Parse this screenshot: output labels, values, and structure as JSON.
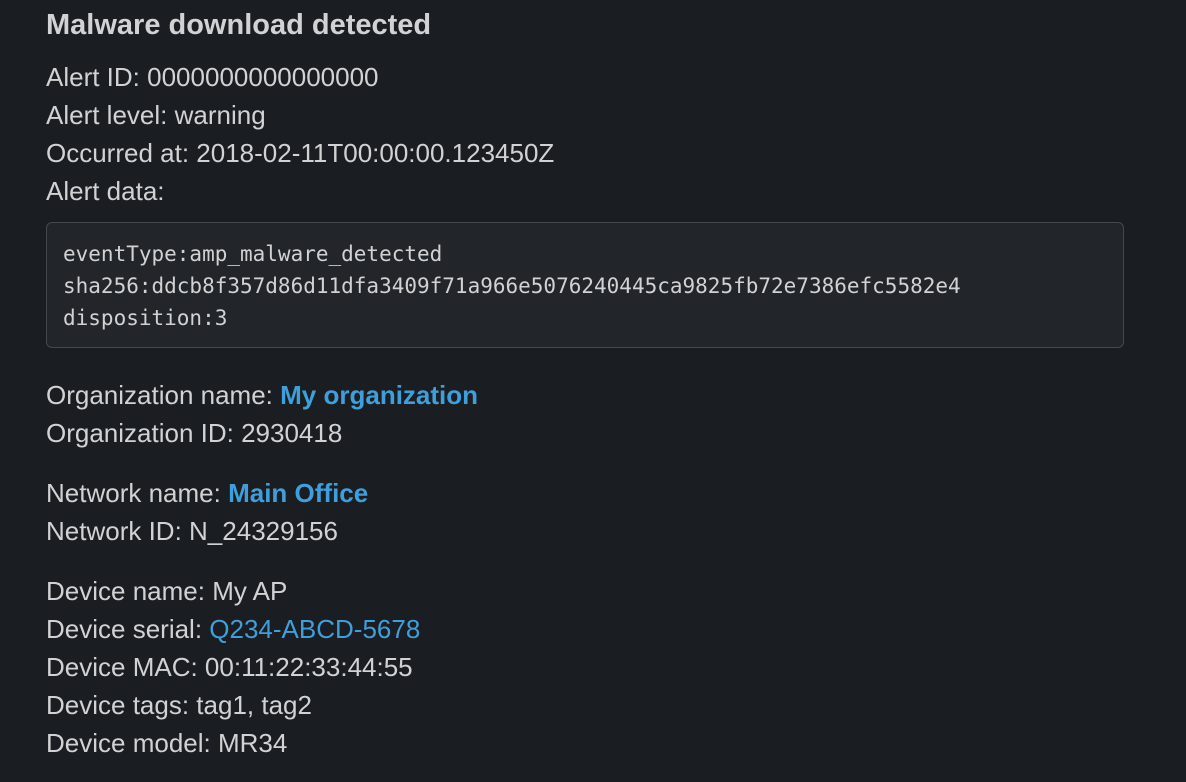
{
  "title": "Malware download detected",
  "alert": {
    "id_label": "Alert ID: ",
    "id_value": "0000000000000000",
    "level_label": "Alert level: ",
    "level_value": "warning",
    "occurred_label": "Occurred at: ",
    "occurred_value": "2018-02-11T00:00:00.123450Z",
    "data_label": "Alert data:",
    "data_lines": [
      "eventType:amp_malware_detected",
      "sha256:ddcb8f357d86d11dfa3409f71a966e5076240445ca9825fb72e7386efc5582e4",
      "disposition:3"
    ]
  },
  "organization": {
    "name_label": "Organization name: ",
    "name_value": "My organization",
    "id_label": "Organization ID: ",
    "id_value": "2930418"
  },
  "network": {
    "name_label": "Network name: ",
    "name_value": "Main Office",
    "id_label": "Network ID: ",
    "id_value": "N_24329156"
  },
  "device": {
    "name_label": "Device name: ",
    "name_value": "My AP",
    "serial_label": "Device serial: ",
    "serial_value": "Q234-ABCD-5678",
    "mac_label": "Device MAC: ",
    "mac_value": "00:11:22:33:44:55",
    "tags_label": "Device tags: ",
    "tags_value": "tag1, tag2",
    "model_label": "Device model: ",
    "model_value": "MR34"
  },
  "colors": {
    "background": "#1a1d21",
    "text": "#d1d2d3",
    "link": "#3f9fdb",
    "code_background": "#222529",
    "code_border": "#45484d"
  }
}
